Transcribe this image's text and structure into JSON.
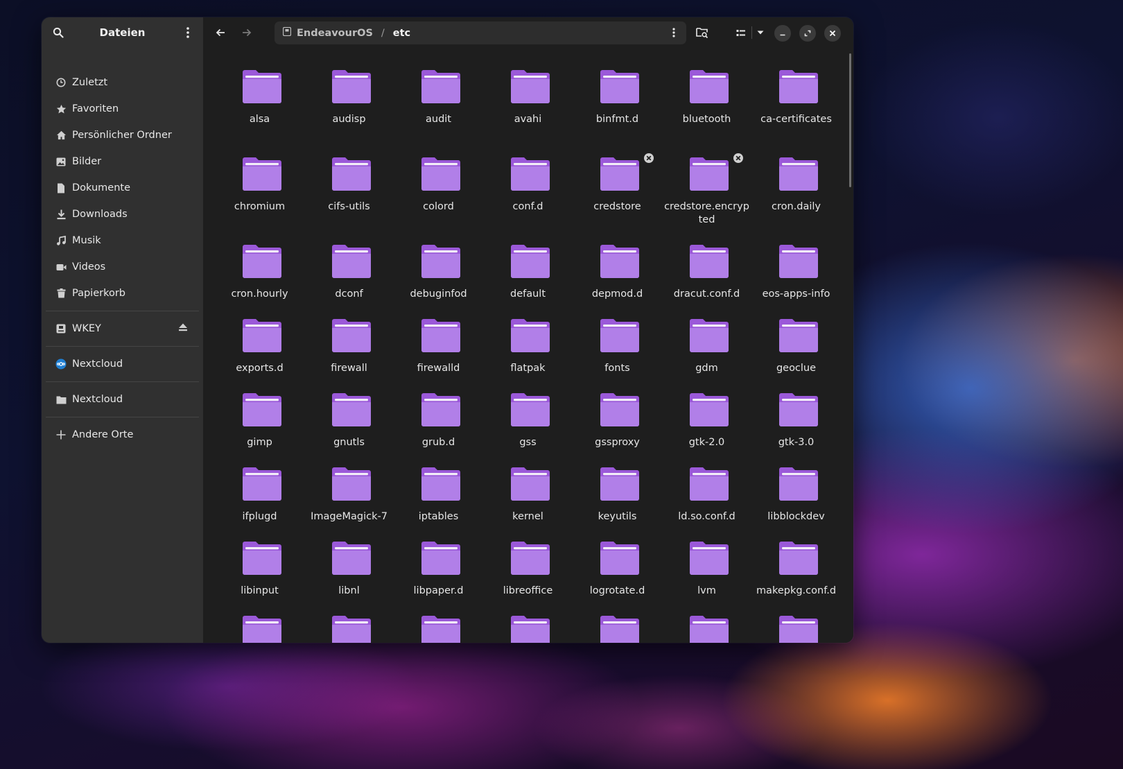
{
  "sidebar": {
    "title": "Dateien",
    "places": [
      {
        "label": "Zuletzt",
        "icon": "clock-icon"
      },
      {
        "label": "Favoriten",
        "icon": "star-icon"
      },
      {
        "label": "Persönlicher Ordner",
        "icon": "home-icon"
      },
      {
        "label": "Bilder",
        "icon": "image-icon"
      },
      {
        "label": "Dokumente",
        "icon": "document-icon"
      },
      {
        "label": "Downloads",
        "icon": "download-icon"
      },
      {
        "label": "Musik",
        "icon": "music-icon"
      },
      {
        "label": "Videos",
        "icon": "video-icon"
      },
      {
        "label": "Papierkorb",
        "icon": "trash-icon"
      }
    ],
    "devices": [
      {
        "label": "WKEY",
        "icon": "drive-icon"
      }
    ],
    "network": [
      {
        "label": "Nextcloud",
        "icon": "nextcloud-icon"
      }
    ],
    "bookmarks": [
      {
        "label": "Nextcloud",
        "icon": "folder-icon"
      }
    ],
    "other": {
      "label": "Andere Orte",
      "icon": "plus-icon"
    }
  },
  "header": {
    "path": [
      "EndeavourOS",
      "etc"
    ],
    "path_separator": "/"
  },
  "colors": {
    "folder": "#9b59d9",
    "folder_light": "#b17fe8",
    "folder_tab": "#f2ecf8"
  },
  "files": [
    {
      "name": "alsa"
    },
    {
      "name": "audisp"
    },
    {
      "name": "audit"
    },
    {
      "name": "avahi"
    },
    {
      "name": "binfmt.d"
    },
    {
      "name": "bluetooth"
    },
    {
      "name": "ca-certificates"
    },
    {
      "name": "chromium"
    },
    {
      "name": "cifs-utils"
    },
    {
      "name": "colord"
    },
    {
      "name": "conf.d"
    },
    {
      "name": "credstore",
      "badge": "x"
    },
    {
      "name": "credstore.encrypted",
      "badge": "x"
    },
    {
      "name": "cron.daily"
    },
    {
      "name": "cron.hourly"
    },
    {
      "name": "dconf"
    },
    {
      "name": "debuginfod"
    },
    {
      "name": "default"
    },
    {
      "name": "depmod.d"
    },
    {
      "name": "dracut.conf.d"
    },
    {
      "name": "eos-apps-info"
    },
    {
      "name": "exports.d"
    },
    {
      "name": "firewall"
    },
    {
      "name": "firewalld"
    },
    {
      "name": "flatpak"
    },
    {
      "name": "fonts"
    },
    {
      "name": "gdm"
    },
    {
      "name": "geoclue"
    },
    {
      "name": "gimp"
    },
    {
      "name": "gnutls"
    },
    {
      "name": "grub.d"
    },
    {
      "name": "gss"
    },
    {
      "name": "gssproxy"
    },
    {
      "name": "gtk-2.0"
    },
    {
      "name": "gtk-3.0"
    },
    {
      "name": "ifplugd"
    },
    {
      "name": "ImageMagick-7"
    },
    {
      "name": "iptables"
    },
    {
      "name": "kernel"
    },
    {
      "name": "keyutils"
    },
    {
      "name": "ld.so.conf.d"
    },
    {
      "name": "libblockdev"
    },
    {
      "name": "libinput"
    },
    {
      "name": "libnl"
    },
    {
      "name": "libpaper.d"
    },
    {
      "name": "libreoffice"
    },
    {
      "name": "logrotate.d"
    },
    {
      "name": "lvm"
    },
    {
      "name": "makepkg.conf.d"
    },
    {
      "name": ""
    },
    {
      "name": ""
    },
    {
      "name": ""
    },
    {
      "name": ""
    },
    {
      "name": ""
    },
    {
      "name": ""
    },
    {
      "name": ""
    }
  ]
}
